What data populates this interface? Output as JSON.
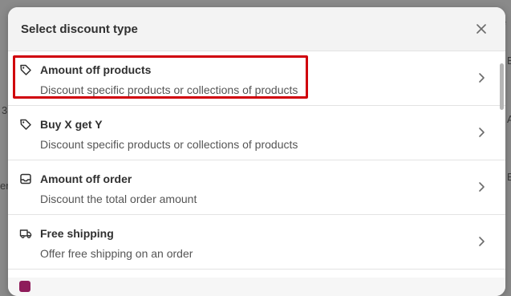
{
  "backdrop": {
    "fragments": [
      "le",
      "3",
      "er",
      "B",
      "A",
      "E"
    ]
  },
  "modal": {
    "title": "Select discount type",
    "close_icon": "close-icon",
    "items": [
      {
        "label": "Amount off products",
        "description": "Discount specific products or collections of products",
        "icon": "tag-icon",
        "selected": true
      },
      {
        "label": "Buy X get Y",
        "description": "Discount specific products or collections of products",
        "icon": "tag-icon"
      },
      {
        "label": "Amount off order",
        "description": "Discount the total order amount",
        "icon": "inbox-icon"
      },
      {
        "label": "Free shipping",
        "description": "Offer free shipping on an order",
        "icon": "truck-icon"
      }
    ]
  },
  "colors": {
    "highlight": "#d0000b",
    "peek_icon": "#8e1b5a"
  }
}
